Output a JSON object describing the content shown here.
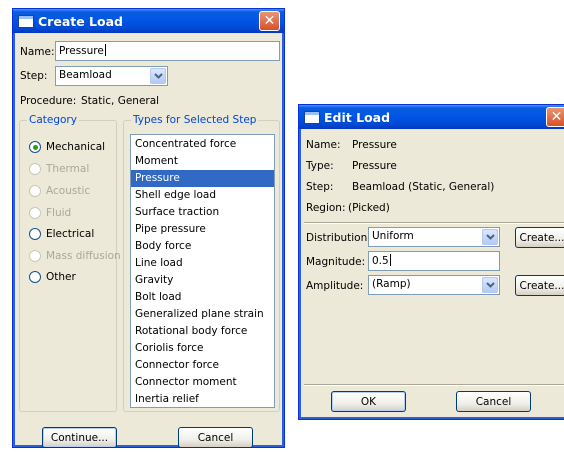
{
  "create_load": {
    "title": "Create Load",
    "name_label": "Name:",
    "name_value": "Pressure",
    "step_label": "Step:",
    "step_value": "Beamload",
    "procedure_label": "Procedure:",
    "procedure_value": "Static, General",
    "category": {
      "legend": "Category",
      "options": [
        {
          "label": "Mechanical",
          "selected": true,
          "enabled": true
        },
        {
          "label": "Thermal",
          "selected": false,
          "enabled": false
        },
        {
          "label": "Acoustic",
          "selected": false,
          "enabled": false
        },
        {
          "label": "Fluid",
          "selected": false,
          "enabled": false
        },
        {
          "label": "Electrical",
          "selected": false,
          "enabled": true
        },
        {
          "label": "Mass diffusion",
          "selected": false,
          "enabled": false
        },
        {
          "label": "Other",
          "selected": false,
          "enabled": true
        }
      ]
    },
    "types": {
      "legend": "Types for Selected Step",
      "items": [
        "Concentrated force",
        "Moment",
        "Pressure",
        "Shell edge load",
        "Surface traction",
        "Pipe pressure",
        "Body force",
        "Line load",
        "Gravity",
        "Bolt load",
        "Generalized plane strain",
        "Rotational body force",
        "Coriolis force",
        "Connector force",
        "Connector moment",
        "Inertia relief"
      ],
      "selected_index": 2
    },
    "continue_label": "Continue...",
    "cancel_label": "Cancel"
  },
  "edit_load": {
    "title": "Edit Load",
    "name_label": "Name:",
    "name_value": "Pressure",
    "type_label": "Type:",
    "type_value": "Pressure",
    "step_label": "Step:",
    "step_value": "Beamload (Static, General)",
    "region_label": "Region:",
    "region_value": "(Picked)",
    "distribution_label": "Distribution:",
    "distribution_value": "Uniform",
    "magnitude_label": "Magnitude:",
    "magnitude_value": "0.5",
    "amplitude_label": "Amplitude:",
    "amplitude_value": "(Ramp)",
    "create_label": "Create...",
    "ok_label": "OK",
    "cancel_label": "Cancel"
  },
  "colors": {
    "titlebar": "#0055e5",
    "dialog_bg": "#ece9d8",
    "selection": "#316ac5",
    "group_legend": "#0046d5",
    "close_button": "#d8502b"
  }
}
